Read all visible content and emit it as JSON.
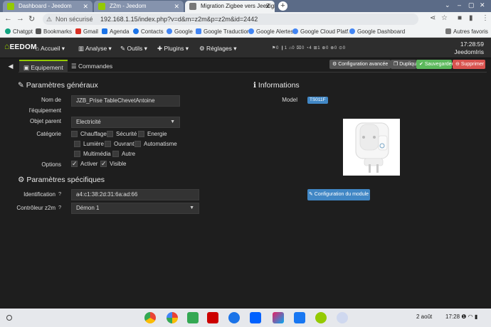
{
  "browser": {
    "tabs": [
      {
        "title": "Dashboard - Jeedom",
        "active": false
      },
      {
        "title": "Z2m - Jeedom",
        "active": false
      },
      {
        "title": "Migration Zigbee vers JeeZigbee",
        "active": true
      }
    ],
    "address": {
      "security_label": "Non sécurisé",
      "url": "192.168.1.15/index.php?v=d&m=z2m&p=z2m&id=2442"
    },
    "bookmarks": [
      {
        "label": "Chatgpt",
        "color": "#10a37f"
      },
      {
        "label": "Bookmarks",
        "color": "#555555"
      },
      {
        "label": "Gmail",
        "color": "#d93025"
      },
      {
        "label": "Agenda",
        "color": "#1a73e8"
      },
      {
        "label": "Contacts",
        "color": "#1a73e8"
      },
      {
        "label": "Google",
        "color": "#4285f4"
      },
      {
        "label": "Google Traduction",
        "color": "#4285f4"
      },
      {
        "label": "Google Alertes",
        "color": "#4285f4"
      },
      {
        "label": "Google Cloud Platf...",
        "color": "#4285f4"
      },
      {
        "label": "Google Dashboard",
        "color": "#4285f4"
      }
    ],
    "other_bookmarks": "Autres favoris"
  },
  "jeedom": {
    "logo": "EEDOM",
    "menu": [
      {
        "label": "Accueil",
        "icon": "home-icon"
      },
      {
        "label": "Analyse",
        "icon": "chart-icon"
      },
      {
        "label": "Outils",
        "icon": "wrench-icon"
      },
      {
        "label": "Plugins",
        "icon": "puzzle-icon"
      },
      {
        "label": "Réglages",
        "icon": "gears-icon"
      }
    ],
    "stats": "⚑0 ❙1 ⌂0 ⌧0 ◔4 ⊞1 ⊕0 ⊗0 ⊙0",
    "time": "17:28:59",
    "host": "JeedomIris"
  },
  "toolbar": {
    "tabs": [
      {
        "label": "Equipement",
        "active": true
      },
      {
        "label": "Commandes",
        "active": false
      }
    ],
    "actions": {
      "advanced": "Configuration avancée",
      "duplicate": "Dupliquer",
      "save": "Sauvegarder",
      "delete": "Supprimer"
    },
    "colors": {
      "save": "#5cb85c",
      "delete": "#d9534f",
      "neutral": "#555555"
    }
  },
  "general": {
    "heading": "Paramètres généraux",
    "name_label_1": "Nom de",
    "name_label_2": "l'équipement",
    "name_value": "JZB_Prise TableChevetAntoine",
    "parent_label": "Objet parent",
    "parent_value": "Electricité",
    "category_label": "Catégorie",
    "categories": [
      {
        "label": "Chauffage",
        "checked": false
      },
      {
        "label": "Sécurité",
        "checked": false
      },
      {
        "label": "Energie",
        "checked": false
      },
      {
        "label": "Lumière",
        "checked": false
      },
      {
        "label": "Ouvrant",
        "checked": false
      },
      {
        "label": "Automatisme",
        "checked": false
      },
      {
        "label": "Multimédia",
        "checked": false
      },
      {
        "label": "Autre",
        "checked": false
      }
    ],
    "options_label": "Options",
    "options": [
      {
        "label": "Activer",
        "checked": true
      },
      {
        "label": "Visible",
        "checked": true
      }
    ]
  },
  "specific": {
    "heading": "Paramètres spécifiques",
    "id_label": "Identification",
    "id_value": "a4:c1:38:2d:31:6a:ad:66",
    "controller_label": "Contrôleur z2m",
    "controller_value": "Démon 1",
    "help": "?"
  },
  "info": {
    "heading": "Informations",
    "model_label": "Model",
    "model_value": "TS011F",
    "config_button": "Configuration du module"
  },
  "shelf": {
    "date": "2 août",
    "time": "17:28"
  }
}
